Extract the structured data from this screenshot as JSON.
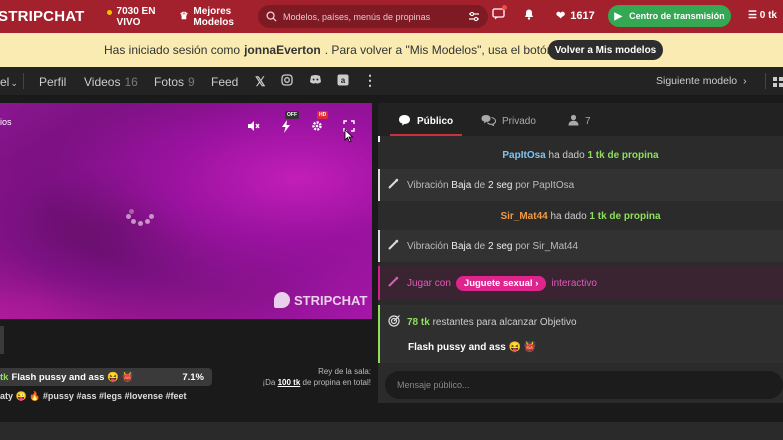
{
  "header": {
    "logo": "STRIPCHAT",
    "live_count": "7030 EN",
    "live_label": "VIVO",
    "best_models_1": "Mejores",
    "best_models_2": "Modelos",
    "search_placeholder": "Modelos, países, menús de propinas",
    "tokens": "1617",
    "broadcast_label": "Centro de transmisión",
    "coins": "0 tk"
  },
  "banner": {
    "text_before": "Has iniciado sesión como",
    "username": "jonnaEverton",
    "text_after": ". Para volver a \"Mis Modelos\", usa el botón.",
    "back_button": "Volver a Mis modelos"
  },
  "nav": {
    "first_fragment": "el",
    "items": [
      {
        "label": "Perfil",
        "count": ""
      },
      {
        "label": "Videos",
        "count": "16"
      },
      {
        "label": "Fotos",
        "count": "9"
      },
      {
        "label": "Feed",
        "count": ""
      }
    ],
    "next_model": "Siguiente modelo"
  },
  "stage": {
    "label_fragment": "ios",
    "badge_off": "OFF",
    "badge_hd": "HD",
    "watermark": "STRIPCHAT"
  },
  "goal": {
    "tk_fragment": "tk",
    "text": "Flash pussy and ass 😝 👹",
    "percent": "7.1%"
  },
  "tags": "aty 😜 🔥 #pussy #ass #legs #lovense #feet",
  "king": {
    "line1": "Rey de la sala:",
    "line2_prefix": "¡Da",
    "line2_amount": "100 tk",
    "line2_suffix": "de propina en total!"
  },
  "chat": {
    "tabs": [
      {
        "label": "Público"
      },
      {
        "label": "Privado"
      },
      {
        "label": "7"
      }
    ],
    "messages": {
      "m1_user": "PapItOsa",
      "m1_mid": "ha dado",
      "m1_tip": "1 tk de propina",
      "m2_prefix": "Vibración",
      "m2_level": "Baja",
      "m2_mid": "de",
      "m2_time": "2 seg",
      "m2_by": "por PapItOsa",
      "m3_user": "Sir_Mat44",
      "m3_mid": "ha dado",
      "m3_tip": "1 tk de propina",
      "m4_prefix": "Vibración",
      "m4_level": "Baja",
      "m4_mid": "de",
      "m4_time": "2 seg",
      "m4_by": "por Sir_Mat44",
      "game_prefix": "Jugar con",
      "game_pill": "Juguete sexual",
      "game_suffix": "interactivo",
      "goal_tk": "78 tk",
      "goal_text": "restantes para alcanzar Objetivo",
      "goal_title": "Flash pussy and ass 😝 👹"
    },
    "input_placeholder": "Mensaje público..."
  },
  "colors": {
    "brand_red": "#a3212d",
    "banner_yellow": "#f9ebb1",
    "green": "#35a853",
    "pink": "#e0248e"
  }
}
